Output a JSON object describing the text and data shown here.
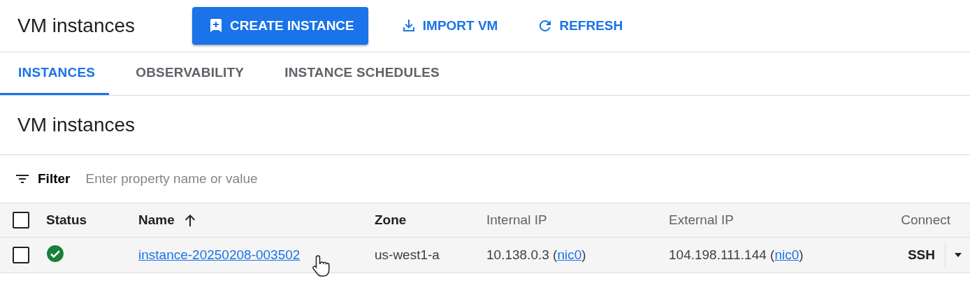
{
  "header": {
    "title": "VM instances",
    "actions": [
      {
        "kind": "create",
        "label": "CREATE INSTANCE"
      },
      {
        "kind": "import",
        "label": "IMPORT VM"
      },
      {
        "kind": "refresh",
        "label": "REFRESH"
      }
    ]
  },
  "tabs": [
    {
      "label": "INSTANCES",
      "selected": true
    },
    {
      "label": "OBSERVABILITY",
      "selected": false
    },
    {
      "label": "INSTANCE SCHEDULES",
      "selected": false
    }
  ],
  "section_title": "VM instances",
  "filter": {
    "label": "Filter",
    "placeholder": "Enter property name or value"
  },
  "table": {
    "select_all_checked": false,
    "columns": [
      {
        "label": "Status",
        "sorted": false
      },
      {
        "label": "Name",
        "sorted": true
      },
      {
        "label": "Zone",
        "sorted": false
      },
      {
        "label": "Internal IP",
        "sorted": false
      },
      {
        "label": "External IP",
        "sorted": false
      },
      {
        "label": "Connect",
        "sorted": false
      }
    ],
    "rows": [
      {
        "checked": false,
        "running": true,
        "name": "instance-20250208-003502",
        "zone": "us-west1-a",
        "internal_ip": {
          "before": "10.138.0.3 (",
          "link": "nic0",
          "after": ")"
        },
        "external_ip": {
          "before": "104.198.111.144 (",
          "link": "nic0",
          "after": ")"
        },
        "connect": "SSH"
      }
    ]
  }
}
